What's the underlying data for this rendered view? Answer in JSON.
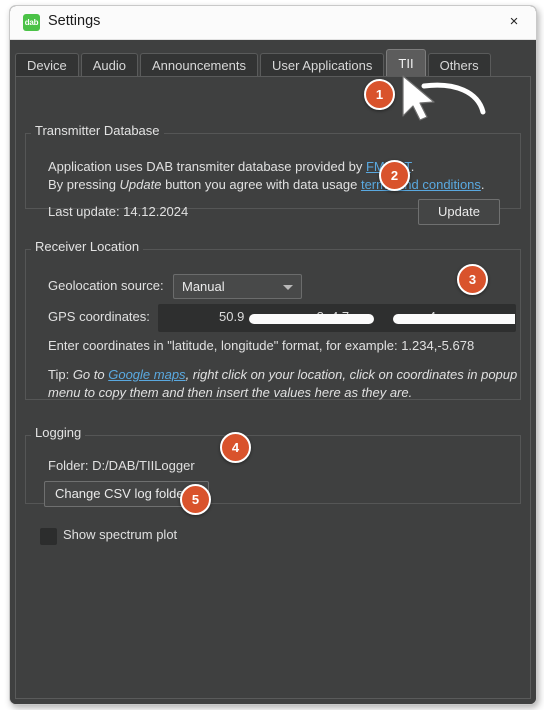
{
  "window": {
    "title": "Settings",
    "icon_label": "dab",
    "close_label": "×"
  },
  "tabs": [
    {
      "label": "Device",
      "active": false
    },
    {
      "label": "Audio",
      "active": false
    },
    {
      "label": "Announcements",
      "active": false
    },
    {
      "label": "User Applications",
      "active": false
    },
    {
      "label": "TII",
      "active": true
    },
    {
      "label": "Others",
      "active": false
    }
  ],
  "transmitter_database": {
    "group_title": "Transmitter Database",
    "line1_prefix": "Application uses DAB transmiter database provided by ",
    "line1_link": "FMLIST",
    "line1_suffix": ".",
    "line2_prefix": "By pressing ",
    "line2_italic": "Update",
    "line2_mid": " button you agree with data usage ",
    "line2_link": "terms and conditions",
    "line2_suffix": ".",
    "last_update_label": "Last update: 14.12.2024",
    "update_button": "Update"
  },
  "receiver_location": {
    "group_title": "Receiver Location",
    "geolocation_label": "Geolocation source:",
    "geolocation_value": "Manual",
    "gps_label": "GPS coordinates:",
    "gps_value_visible_lat": "50.9",
    "gps_value_separator": "8, 4.7",
    "gps_value_tail": "4",
    "hint": "Enter coordinates in \"latitude, longitude\" format, for example: 1.234,-5.678",
    "tip_prefix": "Tip: ",
    "tip_italic_a": "Go to ",
    "tip_link": "Google maps",
    "tip_italic_b": ", right click on your location, click on coordinates in popup",
    "tip_italic_c": "menu to copy them and then insert the values here as they are."
  },
  "logging": {
    "group_title": "Logging",
    "folder_label": "Folder:  D:/DAB/TIILogger",
    "change_folder_button": "Change CSV log folder..."
  },
  "spectrum": {
    "checkbox_label": "Show spectrum plot",
    "checked": false
  },
  "callouts": [
    {
      "number": "1"
    },
    {
      "number": "2"
    },
    {
      "number": "3"
    },
    {
      "number": "4"
    },
    {
      "number": "5"
    }
  ],
  "colors": {
    "window_background": "#3f4040",
    "titlebar_background": "#fbfbfb",
    "accent_badge": "#d9532c",
    "link": "#5aa9e0",
    "icon_green": "#4bc247",
    "active_tab": "#5c5c5c"
  }
}
